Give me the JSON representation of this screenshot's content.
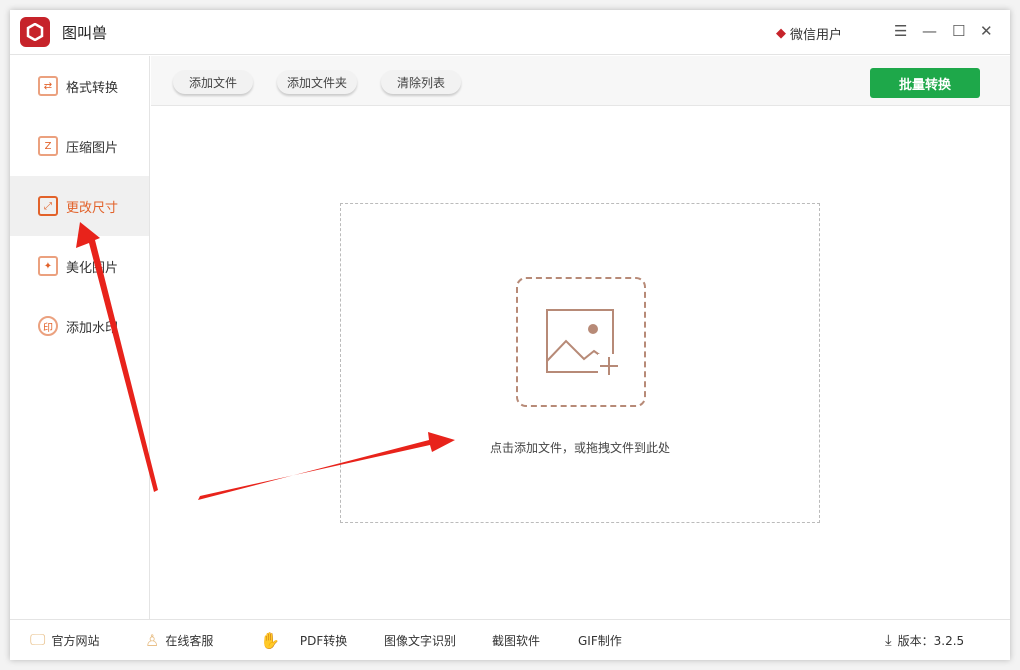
{
  "app": {
    "title": "图叫兽",
    "user": "微信用户",
    "accent": "#e2622a",
    "button_green": "#1ea84a"
  },
  "window_controls": [
    "menu-icon",
    "minimize-icon",
    "maximize-icon",
    "close-icon"
  ],
  "sidebar": {
    "items": [
      {
        "label": "格式转换",
        "icon": "convert-icon"
      },
      {
        "label": "压缩图片",
        "icon": "compress-icon"
      },
      {
        "label": "更改尺寸",
        "icon": "resize-icon",
        "active": true
      },
      {
        "label": "美化图片",
        "icon": "beautify-icon"
      },
      {
        "label": "添加水印",
        "icon": "watermark-icon"
      }
    ]
  },
  "toolbar": {
    "add_file": "添加文件",
    "add_folder": "添加文件夹",
    "clear_list": "清除列表",
    "batch_convert": "批量转换"
  },
  "dropzone": {
    "hint": "点击添加文件，或拖拽文件到此处"
  },
  "footer": {
    "website": "官方网站",
    "support": "在线客服",
    "pdf": "PDF转换",
    "ocr": "图像文字识别",
    "screenshot": "截图软件",
    "gif": "GIF制作",
    "version": "版本：3.2.5"
  }
}
